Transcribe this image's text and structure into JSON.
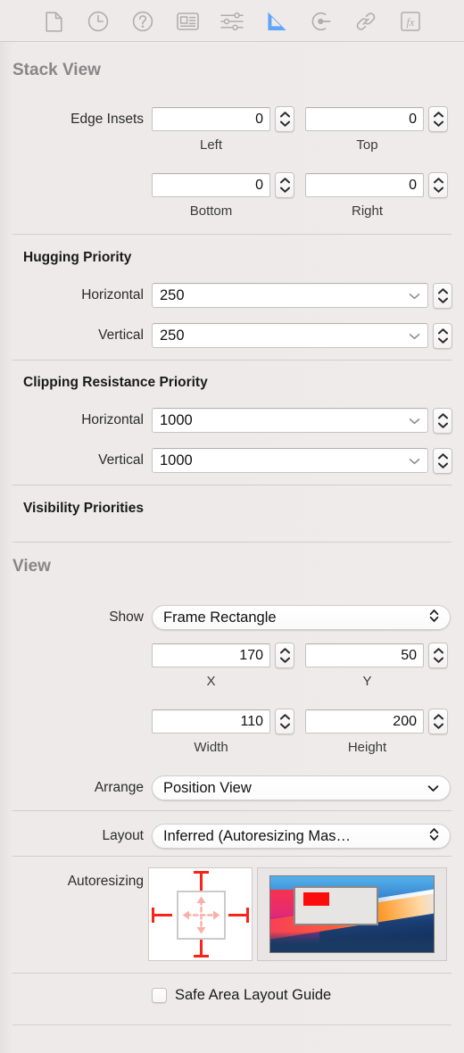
{
  "toolbar": {
    "icons": [
      {
        "name": "file-icon",
        "label": "File"
      },
      {
        "name": "clock-icon",
        "label": "Quick Help"
      },
      {
        "name": "question-mark-icon",
        "label": "Help"
      },
      {
        "name": "identity-card-icon",
        "label": "Identity"
      },
      {
        "name": "sliders-icon",
        "label": "Attributes"
      },
      {
        "name": "ruler-triangle-icon",
        "label": "Size"
      },
      {
        "name": "connections-icon",
        "label": "Connections"
      },
      {
        "name": "link-icon",
        "label": "Bindings"
      },
      {
        "name": "fx-icon",
        "label": "Effects"
      }
    ],
    "selected_index": 5,
    "accent_color": "#60a5f8"
  },
  "stack_view": {
    "title": "Stack View",
    "edge_insets": {
      "label": "Edge Insets",
      "fields": [
        {
          "value": "0",
          "sublabel": "Left"
        },
        {
          "value": "0",
          "sublabel": "Top"
        },
        {
          "value": "0",
          "sublabel": "Bottom"
        },
        {
          "value": "0",
          "sublabel": "Right"
        }
      ]
    },
    "hugging_priority": {
      "heading": "Hugging Priority",
      "rows": [
        {
          "label": "Horizontal",
          "value": "250"
        },
        {
          "label": "Vertical",
          "value": "250"
        }
      ]
    },
    "clipping_resistance_priority": {
      "heading": "Clipping Resistance Priority",
      "rows": [
        {
          "label": "Horizontal",
          "value": "1000"
        },
        {
          "label": "Vertical",
          "value": "1000"
        }
      ]
    },
    "visibility_priorities": {
      "heading": "Visibility Priorities"
    }
  },
  "view": {
    "title": "View",
    "show": {
      "label": "Show",
      "value": "Frame Rectangle"
    },
    "frame": [
      {
        "value": "170",
        "sublabel": "X"
      },
      {
        "value": "50",
        "sublabel": "Y"
      },
      {
        "value": "110",
        "sublabel": "Width"
      },
      {
        "value": "200",
        "sublabel": "Height"
      }
    ],
    "arrange": {
      "label": "Arrange",
      "value": "Position View"
    },
    "layout": {
      "label": "Layout",
      "value": "Inferred (Autoresizing Mas…"
    },
    "autoresizing": {
      "label": "Autoresizing",
      "strut_color": "#fa2318",
      "spring_color": "#f9b0a8"
    },
    "safe_area": {
      "label": "Safe Area Layout Guide",
      "checked": false
    }
  }
}
